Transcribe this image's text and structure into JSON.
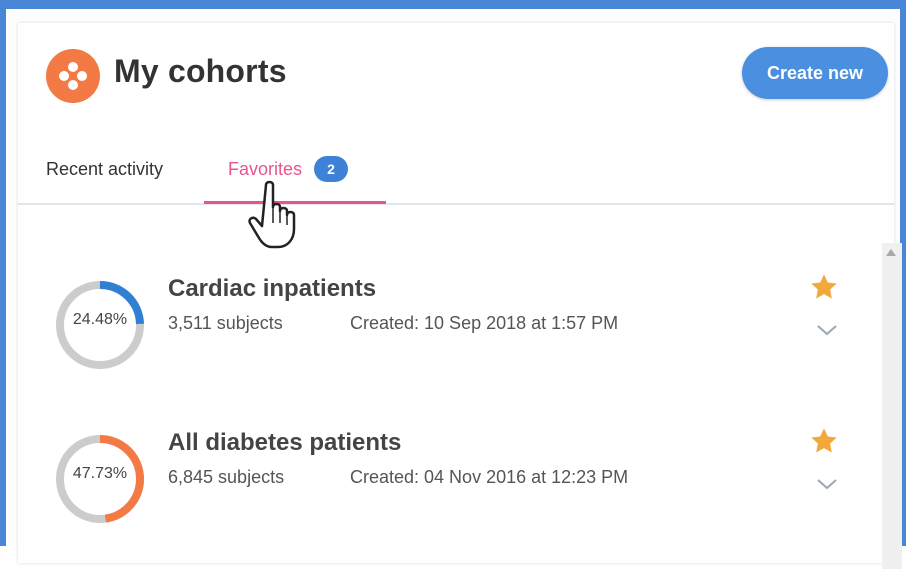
{
  "header": {
    "title": "My cohorts",
    "create_label": "Create new"
  },
  "tabs": [
    {
      "label": "Recent activity",
      "active": false
    },
    {
      "label": "Favorites",
      "active": true,
      "badge": "2"
    }
  ],
  "colors": {
    "accent_blue": "#4a8fe0",
    "tab_pink": "#e8548f",
    "logo_orange": "#f47a45",
    "star_gold": "#f2a93b",
    "ring_track": "#cccccc"
  },
  "icons": {
    "logo": "cohort-logo-icon",
    "favorite": "star-icon",
    "expand": "chevron-down-icon",
    "cursor": "hand-pointer-icon"
  },
  "cohorts": [
    {
      "name": "Cardiac inpatients",
      "percent_label": "24.48%",
      "percent": 24.48,
      "ring_color": "#2f7fd3",
      "subjects": "3,511 subjects",
      "created": "Created: 10 Sep 2018 at 1:57 PM",
      "favorite": true
    },
    {
      "name": "All diabetes patients",
      "percent_label": "47.73%",
      "percent": 47.73,
      "ring_color": "#f47a45",
      "subjects": "6,845 subjects",
      "created": "Created: 04 Nov 2016 at 12:23 PM",
      "favorite": true
    }
  ]
}
